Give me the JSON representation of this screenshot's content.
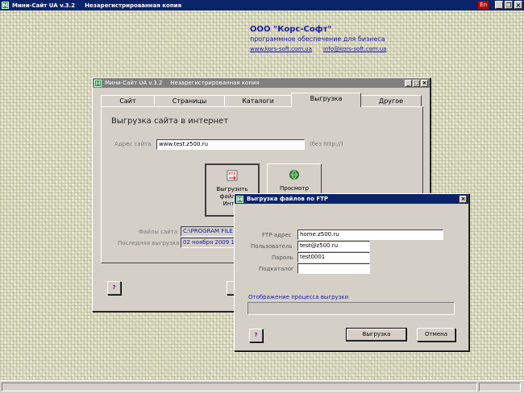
{
  "app_window": {
    "title": "Мини-Сайт UA v.3.2",
    "subtitle": "Незарегистрированная копия",
    "lang_badge": "En"
  },
  "company": {
    "name": "ООО \"Корс-Софт\"",
    "tagline": "программное обеспечение для бизнеса",
    "site_link": "www.kors-soft.com.ua",
    "email_link": "info@kors-soft.com.ua"
  },
  "main_dialog": {
    "title": "Мини-Сайт UA v.3.2",
    "subtitle": "Незарегистрированная копия",
    "tabs": [
      {
        "label": "Сайт",
        "active": false
      },
      {
        "label": "Страницы",
        "active": false
      },
      {
        "label": "Каталоги",
        "active": false
      },
      {
        "label": "Выгрузка",
        "active": true
      },
      {
        "label": "Другое",
        "active": false
      }
    ],
    "heading": "Выгрузка сайта в интернет",
    "site_address_label": "Адрес сайта",
    "site_address_value": "www.test.z500.ru",
    "site_address_hint": "(без http://)",
    "upload_button_label": "Выгрузить файлы сайта в Интернет",
    "upload_button_visible": "Выгрузить\nфайлы с\nИнтер",
    "preview_button_label": "Просмотр\nрезультатов",
    "site_files_label": "Файлы сайта",
    "site_files_value": "C:\\PROGRAM FILE",
    "last_upload_label": "Последняя выгрузка",
    "last_upload_value": "02 ноября 2009 1",
    "help_label": "?"
  },
  "ftp_dialog": {
    "title": "Выгрузка файлов по FTP",
    "ftp_address_label": "FTP-адрес",
    "ftp_address_value": "home.z500.ru",
    "user_label": "Пользователь",
    "user_value": "test@z500.ru",
    "password_label": "Пароль",
    "password_value": "test0001",
    "subdir_label": "Подкаталог",
    "subdir_value": "",
    "progress_label": "Отображение процесса выгрузки",
    "progress": 0,
    "help_label": "?",
    "upload_label": "Выгрузка",
    "cancel_label": "Отмена"
  },
  "colors": {
    "titlebar_active": "#0a246a",
    "link_blue": "#1a1aa8",
    "window_face": "#d4d0c8"
  }
}
